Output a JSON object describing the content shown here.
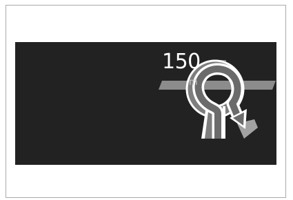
{
  "guidance": {
    "distance_value": "150",
    "distance_unit": "m",
    "maneuver_icon": "roundabout-exit-icon"
  }
}
